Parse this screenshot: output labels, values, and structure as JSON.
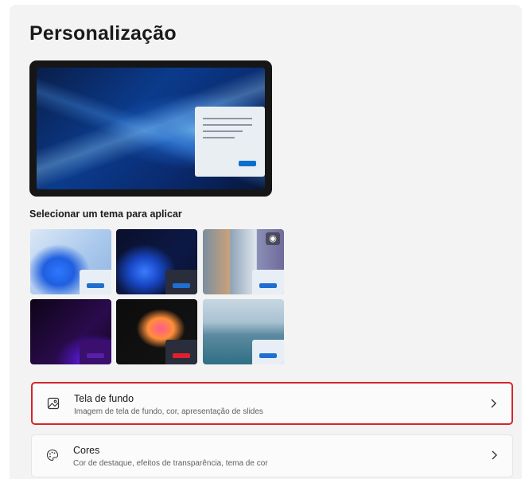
{
  "page": {
    "title": "Personalização"
  },
  "themes": {
    "label": "Selecionar um tema para aplicar",
    "items": [
      {
        "name": "windows-light",
        "accent": "#1f6fd1"
      },
      {
        "name": "windows-dark",
        "accent": "#1f6fd1"
      },
      {
        "name": "windows-spotlight",
        "accent": "#1f6fd1"
      },
      {
        "name": "glow",
        "accent": "#5a1fa8"
      },
      {
        "name": "captured-motion",
        "accent": "#e0212b"
      },
      {
        "name": "flow",
        "accent": "#1f6fd1"
      }
    ]
  },
  "cards": [
    {
      "icon": "image-icon",
      "title": "Tela de fundo",
      "subtitle": "Imagem de tela de fundo, cor, apresentação de slides"
    },
    {
      "icon": "palette-icon",
      "title": "Cores",
      "subtitle": "Cor de destaque, efeitos de transparência, tema de cor"
    }
  ],
  "colors": {
    "highlight": "#d4252e",
    "accent": "#0b6fce"
  }
}
